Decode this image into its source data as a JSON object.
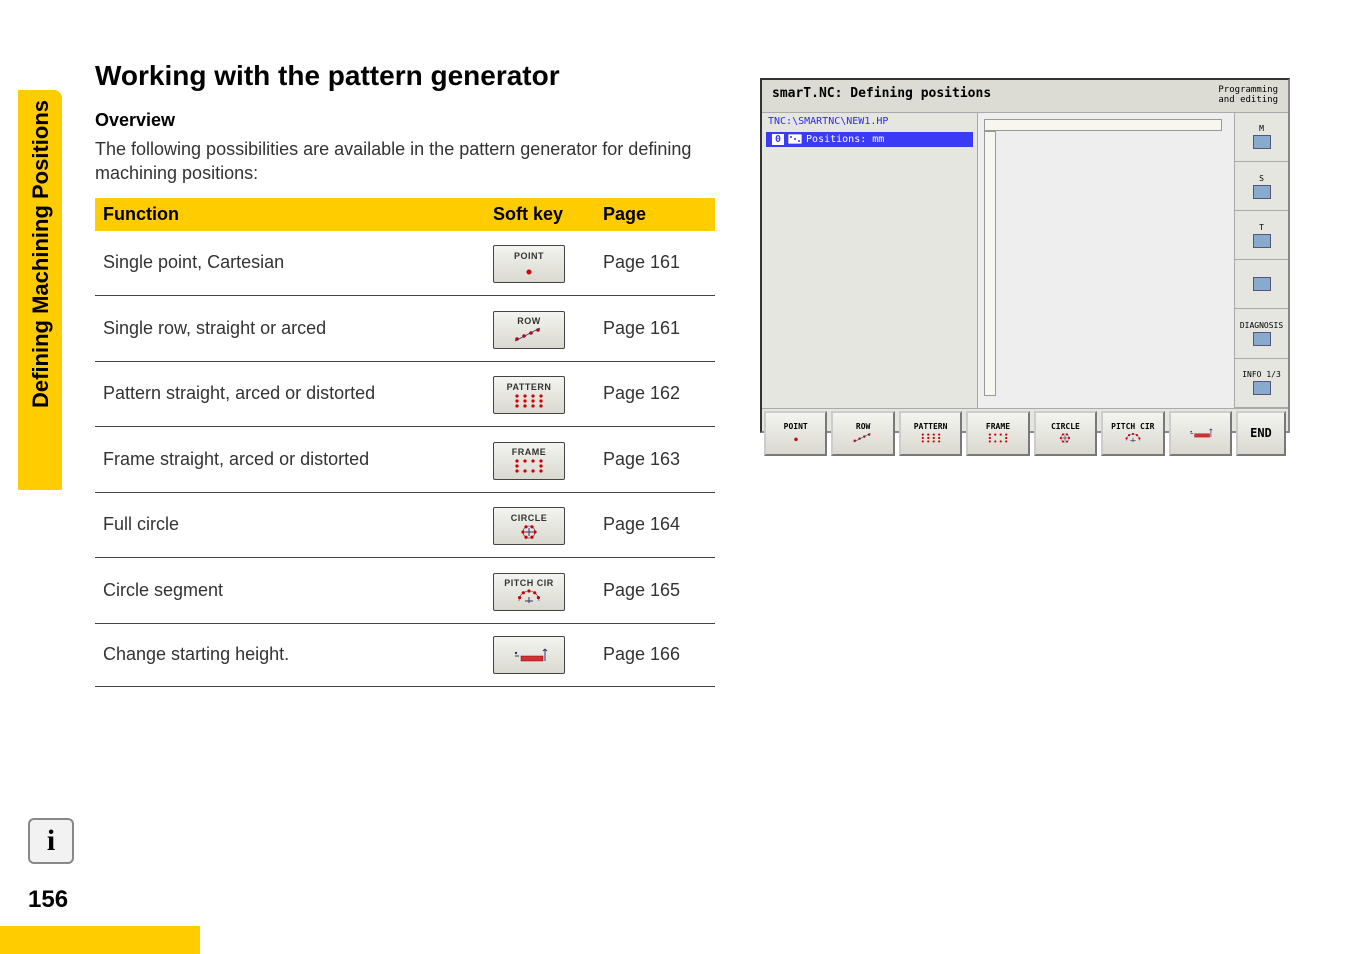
{
  "page_number": "156",
  "sidebar_tab": "Defining Machining Positions",
  "heading": "Working with the pattern generator",
  "subheading": "Overview",
  "intro": "The following possibilities are available in the pattern generator for defining machining positions:",
  "table": {
    "headers": {
      "c1": "Function",
      "c2": "Soft key",
      "c3": "Page"
    },
    "rows": [
      {
        "fn": "Single point, Cartesian",
        "sk": "POINT",
        "page": "Page 161",
        "icon": "point"
      },
      {
        "fn": "Single row, straight or arced",
        "sk": "ROW",
        "page": "Page 161",
        "icon": "row"
      },
      {
        "fn": "Pattern straight, arced or distorted",
        "sk": "PATTERN",
        "page": "Page 162",
        "icon": "pattern"
      },
      {
        "fn": "Frame straight, arced or distorted",
        "sk": "FRAME",
        "page": "Page 163",
        "icon": "frame"
      },
      {
        "fn": "Full circle",
        "sk": "CIRCLE",
        "page": "Page 164",
        "icon": "circle"
      },
      {
        "fn": "Circle segment",
        "sk": "PITCH CIR",
        "page": "Page 165",
        "icon": "pitch"
      },
      {
        "fn": "Change starting height.",
        "sk": "",
        "page": "Page 166",
        "icon": "height"
      }
    ]
  },
  "screenshot": {
    "title": "smarT.NC: Defining positions",
    "mode_line1": "Programming",
    "mode_line2": "and editing",
    "path": "TNC:\\SMARTNC\\NEW1.HP",
    "item_num": "0",
    "item_text": "Positions: mm",
    "right_panel": [
      {
        "label": "M"
      },
      {
        "label": "S"
      },
      {
        "label": "T"
      },
      {
        "label": ""
      },
      {
        "label": "DIAGNOSIS"
      },
      {
        "label": "INFO 1/3"
      }
    ],
    "softkeys": [
      {
        "label": "POINT",
        "icon": "point"
      },
      {
        "label": "ROW",
        "icon": "row"
      },
      {
        "label": "PATTERN",
        "icon": "pattern"
      },
      {
        "label": "FRAME",
        "icon": "frame"
      },
      {
        "label": "CIRCLE",
        "icon": "circle"
      },
      {
        "label": "PITCH CIR",
        "icon": "pitch"
      },
      {
        "label": "",
        "icon": "height"
      }
    ],
    "end_button": "END"
  }
}
